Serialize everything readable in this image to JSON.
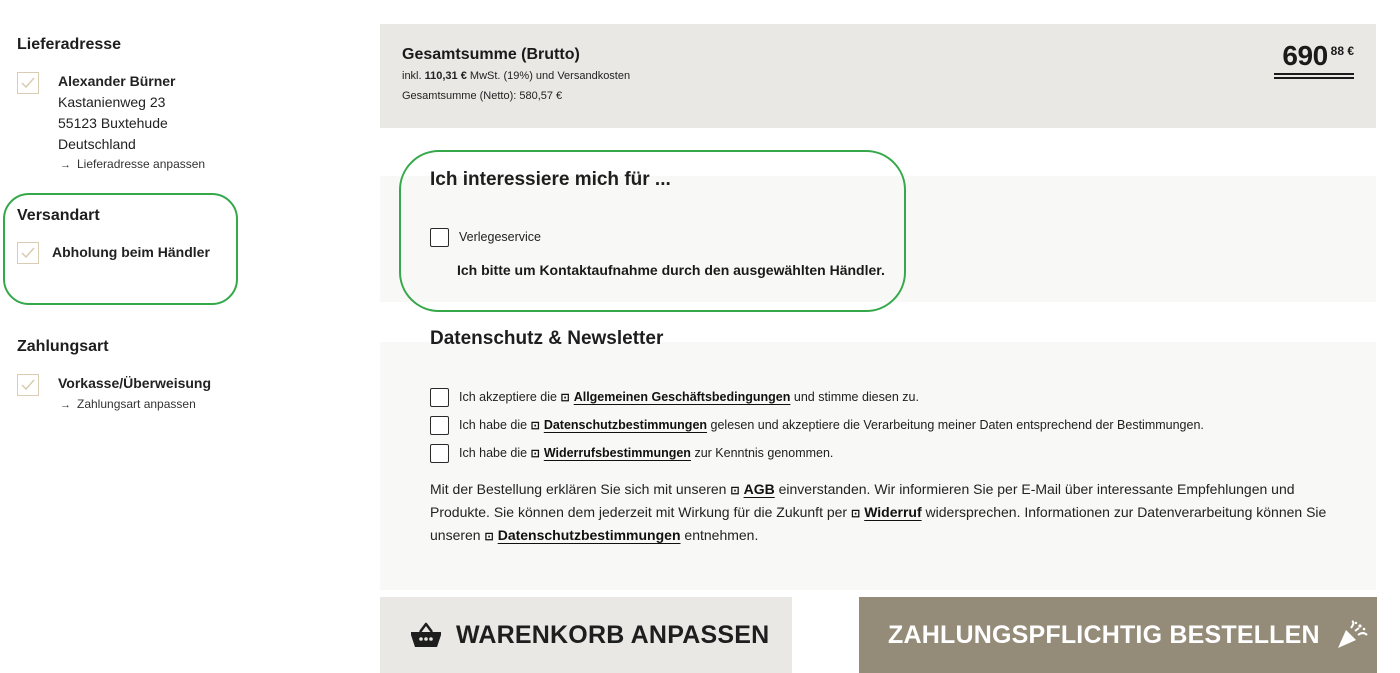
{
  "delivery": {
    "title": "Lieferadresse",
    "name": "Alexander Bürner",
    "street": "Kastanienweg 23",
    "city": "55123 Buxtehude",
    "country": "Deutschland",
    "adjust_link": "Lieferadresse anpassen"
  },
  "shipping": {
    "title": "Versandart",
    "method": "Abholung beim Händler"
  },
  "payment": {
    "title": "Zahlungsart",
    "method": "Vorkasse/Überweisung",
    "adjust_link": "Zahlungsart anpassen"
  },
  "total": {
    "title": "Gesamtsumme (Brutto)",
    "vat_prefix": "inkl.",
    "vat_amount": "110,31 €",
    "vat_suffix": "MwSt. (19%) und Versandkosten",
    "net": "Gesamtsumme (Netto): 580,57 €",
    "price_main": "690",
    "price_cents": "88 €"
  },
  "interest": {
    "title": "Ich interessiere mich für ...",
    "option_label": "Verlegeservice",
    "option_checked": false,
    "note": "Ich bitte um Kontaktaufnahme durch den ausgewählten Händler."
  },
  "privacy": {
    "title": "Datenschutz & Newsletter",
    "agb": {
      "pre": "Ich akzeptiere die",
      "link": "Allgemeinen Geschäftsbedingungen",
      "post": "und stimme diesen zu.",
      "checked": false
    },
    "dsgvo": {
      "pre": "Ich habe die",
      "link": "Datenschutzbestimmungen",
      "post": "gelesen und akzeptiere die Verarbeitung meiner Daten entsprechend der Bestimmungen.",
      "checked": false
    },
    "widerruf": {
      "pre": "Ich habe die",
      "link": "Widerrufsbestimmungen",
      "post": "zur Kenntnis genommen.",
      "checked": false
    },
    "para": {
      "t1": "Mit der Bestellung erklären Sie sich mit unseren",
      "l1": "AGB",
      "t2": "einverstanden. Wir informieren Sie per E-Mail über interessante Empfehlungen und Produkte. Sie können dem jederzeit mit Wirkung für die Zukunft per",
      "l2": "Widerruf",
      "t3": "widersprechen. Informationen zur Datenverarbeitung können Sie unseren",
      "l3": "Datenschutzbestimmungen",
      "t4": "entnehmen."
    }
  },
  "buttons": {
    "basket": "WARENKORB ANPASSEN",
    "order": "ZAHLUNGSPFLICHTIG BESTELLEN"
  },
  "icons": {
    "check": "check-icon",
    "arrow": "arrow-right-icon",
    "link": "external-link-icon",
    "basket": "basket-icon",
    "celebrate": "party-popper-icon"
  },
  "colors": {
    "accent_check": "#d9ccb2",
    "order_button": "#948c79",
    "highlight": "#35a84a"
  }
}
